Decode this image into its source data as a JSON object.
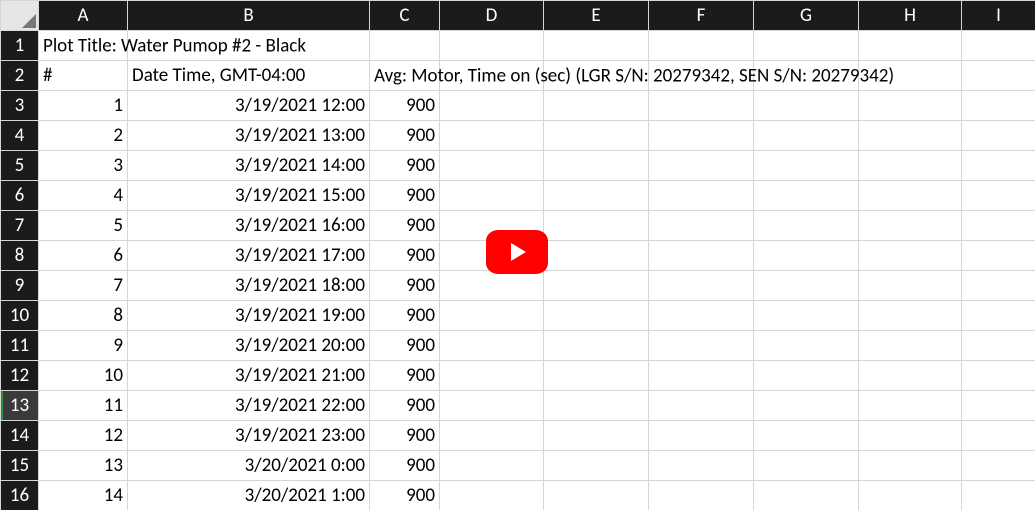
{
  "columns": [
    "A",
    "B",
    "C",
    "D",
    "E",
    "F",
    "G",
    "H",
    "I"
  ],
  "row_numbers": [
    1,
    2,
    3,
    4,
    5,
    6,
    7,
    8,
    9,
    10,
    11,
    12,
    13,
    14,
    15,
    16
  ],
  "selected_row": 13,
  "title_row": {
    "A": "Plot Title: Water Pumop #2 - Black"
  },
  "header_row": {
    "A": "#",
    "B": "Date Time, GMT-04:00",
    "C": "Avg: Motor, Time on (sec) (LGR S/N: 20279342, SEN S/N: 20279342)"
  },
  "data_rows": [
    {
      "n": 1,
      "dt": "3/19/2021 12:00",
      "v": 900
    },
    {
      "n": 2,
      "dt": "3/19/2021 13:00",
      "v": 900
    },
    {
      "n": 3,
      "dt": "3/19/2021 14:00",
      "v": 900
    },
    {
      "n": 4,
      "dt": "3/19/2021 15:00",
      "v": 900
    },
    {
      "n": 5,
      "dt": "3/19/2021 16:00",
      "v": 900
    },
    {
      "n": 6,
      "dt": "3/19/2021 17:00",
      "v": 900
    },
    {
      "n": 7,
      "dt": "3/19/2021 18:00",
      "v": 900
    },
    {
      "n": 8,
      "dt": "3/19/2021 19:00",
      "v": 900
    },
    {
      "n": 9,
      "dt": "3/19/2021 20:00",
      "v": 900
    },
    {
      "n": 10,
      "dt": "3/19/2021 21:00",
      "v": 900
    },
    {
      "n": 11,
      "dt": "3/19/2021 22:00",
      "v": 900
    },
    {
      "n": 12,
      "dt": "3/19/2021 23:00",
      "v": 900
    },
    {
      "n": 13,
      "dt": "3/20/2021 0:00",
      "v": 900
    },
    {
      "n": 14,
      "dt": "3/20/2021 1:00",
      "v": 900
    }
  ],
  "overlay": {
    "kind": "youtube-play"
  }
}
